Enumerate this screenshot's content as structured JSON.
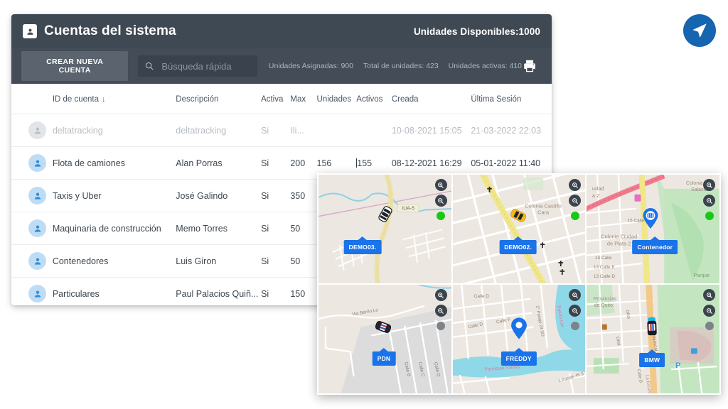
{
  "brand": {
    "logo_icon": "paper-plane-icon",
    "logo_color": "#1565b0"
  },
  "card": {
    "header": {
      "icon": "contact-card-icon",
      "title": "Cuentas del sistema",
      "available_units": "Unidades Disponibles:1000",
      "bg_color": "#3f4954"
    },
    "toolbar": {
      "create_label": "CREAR NUEVA CUENTA",
      "search_placeholder": "Búsqueda rápida",
      "search_value": "",
      "search_icon": "search-icon",
      "print_icon": "printer-icon",
      "stats": [
        "Unidades Asignadas: 900",
        "Total de unidades: 423",
        "Unidades activas: 410"
      ]
    },
    "table": {
      "columns": [
        "",
        "ID de cuenta",
        "Descripción",
        "Activa",
        "Max",
        "Unidades",
        "Activos",
        "Creada",
        "Última Sesión"
      ],
      "sort_column": "ID de cuenta",
      "sort_arrow": "↓",
      "rows": [
        {
          "avatar": "person-icon",
          "id": "deltatracking",
          "desc": "deltatracking",
          "activa": "Si",
          "max": "Ili...",
          "unidades": "",
          "activos": "",
          "creada": "10-08-2021 15:05",
          "ultima": "21-03-2022 22:03",
          "muted": true
        },
        {
          "avatar": "person-icon",
          "id": "Flota de camiones",
          "desc": "Alan Porras",
          "activa": "Si",
          "max": "200",
          "unidades": "156",
          "activos": "155",
          "creada": "08-12-2021 16:29",
          "ultima": "05-01-2022 11:40",
          "muted": false,
          "caret": true
        },
        {
          "avatar": "person-icon",
          "id": "Taxis y Uber",
          "desc": "José Galindo",
          "activa": "Si",
          "max": "350",
          "unidades": "",
          "activos": "",
          "creada": "",
          "ultima": "",
          "muted": false
        },
        {
          "avatar": "person-icon",
          "id": "Maquinaria de construcción",
          "desc": "Memo Torres",
          "activa": "Si",
          "max": "50",
          "unidades": "",
          "activos": "",
          "creada": "",
          "ultima": "",
          "muted": false
        },
        {
          "avatar": "person-icon",
          "id": "Contenedores",
          "desc": "Luis Giron",
          "activa": "Si",
          "max": "50",
          "unidades": "",
          "activos": "",
          "creada": "",
          "ultima": "",
          "muted": false
        },
        {
          "avatar": "person-icon",
          "id": "Particulares",
          "desc": "Paul Palacios Quiñ...",
          "activa": "Si",
          "max": "150",
          "unidades": "",
          "activos": "",
          "creada": "",
          "ultima": "",
          "muted": false
        }
      ]
    }
  },
  "maps": {
    "zoom_in_icon": "zoom-in-icon",
    "zoom_out_icon": "zoom-out-icon",
    "cells": [
      {
        "label": "DEMO03.",
        "marker": "car-white-icon",
        "status": "green",
        "road_label": "IUA-5"
      },
      {
        "label": "DEMO02.",
        "marker": "car-yellow-icon",
        "status": "green",
        "place": "Colonia Castillo Cara"
      },
      {
        "label": "Contenedor",
        "marker": "container-pin-icon",
        "status": "green",
        "place": "Colonia Ciudad de Plata 2"
      },
      {
        "label": "PDN",
        "marker": "car-police-icon",
        "status": "grey",
        "road_label": "Via Barrio Lo"
      },
      {
        "label": "FREDDY",
        "marker": "map-pin-icon",
        "status": "grey",
        "place": "Parroquia Fabres"
      },
      {
        "label": "BMW",
        "marker": "car-blue-icon",
        "status": "grey",
        "place": "Provincias de Quito"
      }
    ]
  }
}
